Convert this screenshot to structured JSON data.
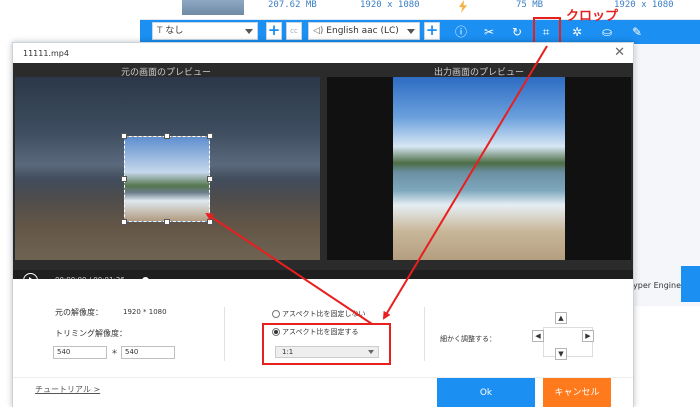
{
  "background_app": {
    "file_size_1": "207.62 MB",
    "resolution_1": "1920 x 1080",
    "file_size_2": "75 MB",
    "resolution_2": "1920 x 1080",
    "subtitle_value": "なし",
    "audio_value": "English aac (LC)",
    "cc_label": "cc",
    "hyper_engine_label": "Hyper Engine"
  },
  "annotation": {
    "crop_label": "クロップ",
    "accent_color": "#e81f1f"
  },
  "dialog": {
    "title": "11111.mp4",
    "close_symbol": "✕",
    "source_preview_label": "元の画面のプレビュー",
    "output_preview_label": "出力画面のプレビュー",
    "current_time": "00:00:00",
    "time_separator": "/",
    "total_time": "00:01:26",
    "source_resolution_label": "元の解像度：",
    "source_resolution_value": "1920 * 1080",
    "trim_resolution_label": "トリミング解像度：",
    "trim_width": "540",
    "trim_height": "540",
    "trim_separator": "＊",
    "radio_unlock_label": "アスペクト比を固定しない",
    "radio_lock_label": "アスペクト比を固定する",
    "selected_ratio": "1:1",
    "fine_adjust_label": "細かく調整する：",
    "tutorial_label": "チュートリアル >",
    "ok_label": "Ok",
    "cancel_label": "キャンセル"
  },
  "colors": {
    "primary_blue": "#1b8ff2",
    "cancel_orange": "#ff7a1c"
  }
}
